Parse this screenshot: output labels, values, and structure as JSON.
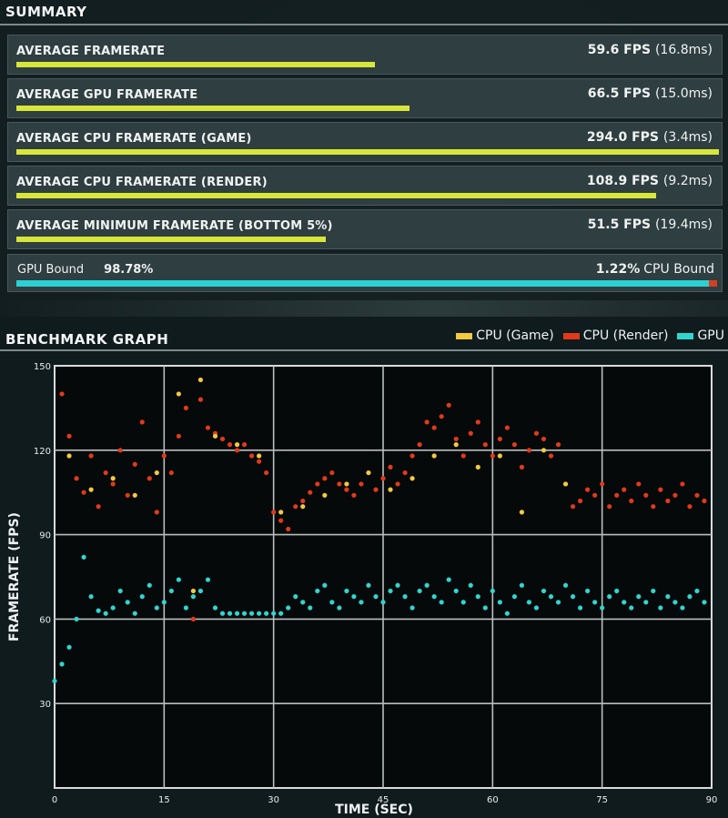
{
  "summary": {
    "title": "SUMMARY",
    "rows": [
      {
        "label": "AVERAGE FRAMERATE",
        "fps": "59.6 FPS",
        "ms": "(16.8ms)",
        "fill": 0.51
      },
      {
        "label": "AVERAGE GPU FRAMERATE",
        "fps": "66.5 FPS",
        "ms": "(15.0ms)",
        "fill": 0.56
      },
      {
        "label": "AVERAGE CPU FRAMERATE (GAME)",
        "fps": "294.0 FPS",
        "ms": "(3.4ms)",
        "fill": 1.0
      },
      {
        "label": "AVERAGE CPU FRAMERATE (RENDER)",
        "fps": "108.9 FPS",
        "ms": "(9.2ms)",
        "fill": 0.91
      },
      {
        "label": "AVERAGE MINIMUM FRAMERATE (BOTTOM 5%)",
        "fps": "51.5 FPS",
        "ms": "(19.4ms)",
        "fill": 0.44
      }
    ],
    "bound": {
      "gpu_label": "GPU Bound",
      "gpu_pct": "98.78%",
      "cpu_pct": "1.22%",
      "cpu_label": "CPU Bound",
      "gpu_fraction": 0.9878
    }
  },
  "graph": {
    "title": "BENCHMARK GRAPH",
    "colors": {
      "cpu_game": "#f3c93f",
      "cpu_render": "#e2391a",
      "gpu": "#2fd6cf"
    }
  },
  "chart_data": {
    "type": "scatter",
    "title": "BENCHMARK GRAPH",
    "xlabel": "TIME (SEC)",
    "ylabel": "FRAMERATE (FPS)",
    "xlim": [
      0,
      90
    ],
    "ylim": [
      0,
      150
    ],
    "xticks": [
      "0",
      "15",
      "30",
      "45",
      "60",
      "75",
      "90"
    ],
    "yticks": [
      "30",
      "60",
      "90",
      "120",
      "150"
    ],
    "grid": true,
    "legend_position": "top-right",
    "series": [
      {
        "name": "CPU (Game)",
        "color": "#f3c93f",
        "x": [
          2,
          5,
          8,
          11,
          14,
          17,
          19,
          20,
          22,
          25,
          28,
          31,
          34,
          37,
          40,
          43,
          46,
          49,
          52,
          55,
          58,
          61,
          64,
          67,
          70
        ],
        "y": [
          118,
          106,
          110,
          104,
          112,
          140,
          70,
          145,
          125,
          122,
          118,
          98,
          100,
          104,
          108,
          112,
          106,
          110,
          118,
          122,
          114,
          118,
          98,
          120,
          108
        ]
      },
      {
        "name": "CPU (Render)",
        "color": "#e2391a",
        "x": [
          1,
          2,
          3,
          4,
          5,
          6,
          7,
          8,
          9,
          10,
          11,
          12,
          13,
          14,
          15,
          16,
          17,
          18,
          19,
          20,
          21,
          22,
          23,
          24,
          25,
          26,
          27,
          28,
          29,
          30,
          31,
          32,
          33,
          34,
          35,
          36,
          37,
          38,
          39,
          40,
          41,
          42,
          43,
          44,
          45,
          46,
          47,
          48,
          49,
          50,
          51,
          52,
          53,
          54,
          55,
          56,
          57,
          58,
          59,
          60,
          61,
          62,
          63,
          64,
          65,
          66,
          67,
          68,
          69,
          70,
          71,
          72,
          73,
          74,
          75,
          76,
          77,
          78,
          79,
          80,
          81,
          82,
          83,
          84,
          85,
          86,
          87,
          88,
          89
        ],
        "y": [
          140,
          125,
          110,
          105,
          118,
          100,
          112,
          108,
          120,
          104,
          115,
          130,
          110,
          98,
          118,
          112,
          125,
          135,
          60,
          138,
          128,
          126,
          124,
          122,
          120,
          122,
          118,
          116,
          112,
          98,
          95,
          92,
          100,
          102,
          105,
          108,
          110,
          112,
          108,
          106,
          104,
          108,
          112,
          106,
          110,
          114,
          108,
          112,
          118,
          122,
          130,
          128,
          132,
          136,
          124,
          118,
          126,
          130,
          122,
          118,
          124,
          128,
          122,
          114,
          120,
          126,
          124,
          118,
          122,
          108,
          100,
          102,
          106,
          104,
          108,
          100,
          104,
          106,
          102,
          108,
          104,
          100,
          106,
          102,
          104,
          108,
          100,
          104,
          102
        ]
      },
      {
        "name": "GPU",
        "color": "#2fd6cf",
        "x": [
          0,
          1,
          2,
          3,
          4,
          5,
          6,
          7,
          8,
          9,
          10,
          11,
          12,
          13,
          14,
          15,
          16,
          17,
          18,
          19,
          20,
          21,
          22,
          23,
          24,
          25,
          26,
          27,
          28,
          29,
          30,
          31,
          32,
          33,
          34,
          35,
          36,
          37,
          38,
          39,
          40,
          41,
          42,
          43,
          44,
          45,
          46,
          47,
          48,
          49,
          50,
          51,
          52,
          53,
          54,
          55,
          56,
          57,
          58,
          59,
          60,
          61,
          62,
          63,
          64,
          65,
          66,
          67,
          68,
          69,
          70,
          71,
          72,
          73,
          74,
          75,
          76,
          77,
          78,
          79,
          80,
          81,
          82,
          83,
          84,
          85,
          86,
          87,
          88,
          89
        ],
        "y": [
          38,
          44,
          50,
          60,
          82,
          68,
          63,
          62,
          64,
          70,
          66,
          62,
          68,
          72,
          64,
          66,
          70,
          74,
          64,
          68,
          70,
          74,
          64,
          62,
          62,
          62,
          62,
          62,
          62,
          62,
          62,
          62,
          64,
          68,
          66,
          64,
          70,
          72,
          66,
          64,
          70,
          68,
          66,
          72,
          68,
          66,
          70,
          72,
          68,
          64,
          70,
          72,
          68,
          66,
          74,
          70,
          66,
          72,
          68,
          64,
          70,
          66,
          62,
          68,
          72,
          66,
          64,
          70,
          68,
          66,
          72,
          68,
          64,
          70,
          66,
          64,
          68,
          70,
          66,
          64,
          68,
          66,
          70,
          64,
          68,
          66,
          64,
          68,
          70,
          66
        ]
      }
    ]
  }
}
